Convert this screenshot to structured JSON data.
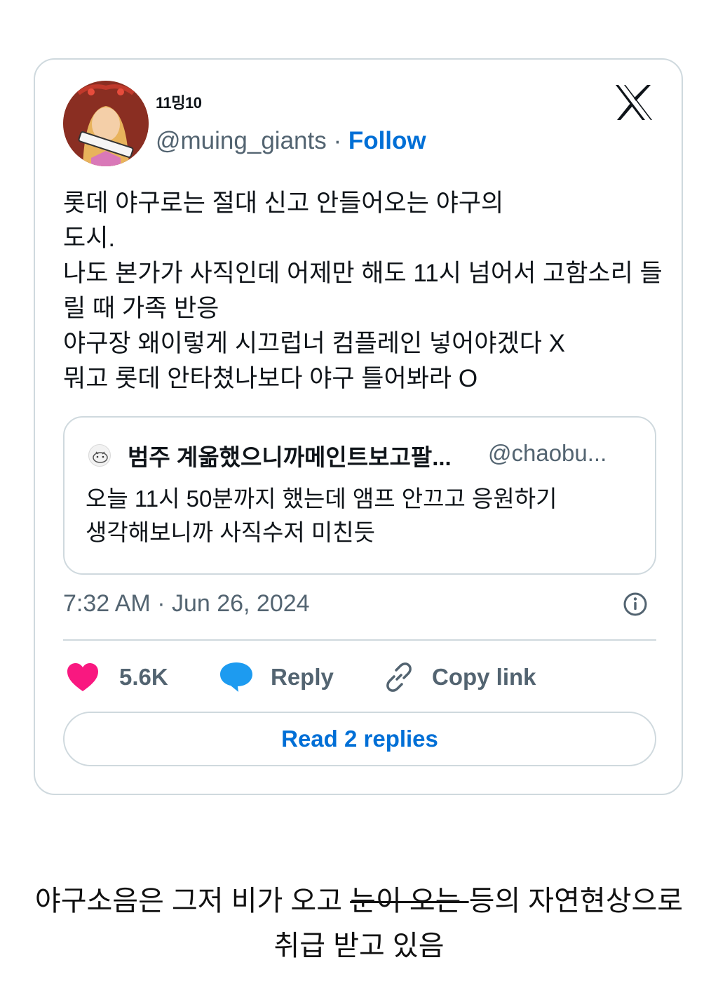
{
  "tweet": {
    "display_name": "11밍10",
    "handle": "@muing_giants",
    "separator": " · ",
    "follow_label": "Follow",
    "text": "롯데 야구로는 절대 신고 안들어오는 야구의\n도시.\n나도 본가가 사직인데 어제만 해도 11시 넘어서 고함소리 들\n릴 때 가족 반응\n야구장 왜이렇게 시끄럽너 컴플레인 넣어야겠다 X\n뭐고 롯데 안타쳤나보다 야구 틀어봐라 O",
    "timestamp": "7:32 AM · Jun 26, 2024"
  },
  "quote": {
    "name": "범주 계옮했으니까메인트보고팔...",
    "handle": "@chaobu...",
    "text": "오늘 11시 50분까지 했는데 앰프 안끄고 응원하기\n생각해보니까 사직수저 미친듯"
  },
  "actions": {
    "like_count": "5.6K",
    "reply_label": "Reply",
    "copy_link_label": "Copy link",
    "read_replies_label": "Read 2 replies"
  },
  "caption": {
    "part1": "야구소음은 그저 비가 오고 ",
    "struck": "눈이 오는 ",
    "part2": "등의 자연현상으로",
    "line2": "취급 받고 있음"
  },
  "icons": {
    "brand": "x-logo-icon",
    "like": "heart-icon",
    "reply": "speech-bubble-icon",
    "copy": "link-icon",
    "info": "info-icon"
  },
  "colors": {
    "link_blue": "#006fd6",
    "heart": "#f91880",
    "reply_bubble": "#1d9bf0",
    "muted": "#536471",
    "border": "#cfd9de"
  }
}
